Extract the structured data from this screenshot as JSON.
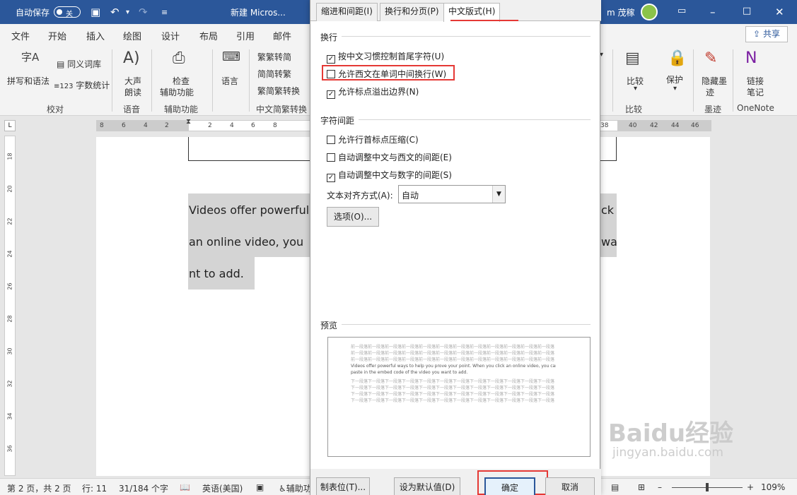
{
  "titlebar": {
    "autosave_label": "自动保存",
    "autosave_state": "关",
    "doc_title": "新建 Micros...",
    "user_name": "m 茂稼"
  },
  "ribbon_tabs": [
    "文件",
    "开始",
    "插入",
    "绘图",
    "设计",
    "布局",
    "引用",
    "邮件"
  ],
  "share_label": "共享",
  "ribbon": {
    "spell_label": "拼写和语法",
    "thesaurus_label": "同义词库",
    "wordcount_label": "字数统计",
    "proofing_group": "校对",
    "readaloud_label1": "大声",
    "readaloud_label2": "朗读",
    "speech_group": "语音",
    "check_label1": "检查",
    "check_label2": "辅助功能",
    "access_group": "辅助功能",
    "language_label": "语言",
    "trad_to_simp": "繁转简",
    "simp_to_trad": "简转繁",
    "convert_label": "简繁转换",
    "chinese_group": "中文简繁转换",
    "compare_label": "比较",
    "compare_group": "比较",
    "protect_label": "保护",
    "hide_ink_label1": "隐藏墨",
    "hide_ink_label2": "迹",
    "ink_group": "墨迹",
    "notes_label1": "链接",
    "notes_label2": "笔记",
    "onenote_group": "OneNote",
    "ruler_corner": "L"
  },
  "ruler": {
    "h_left": [
      "8",
      "6",
      "4",
      "2"
    ],
    "h_mid": [
      "2",
      "4",
      "6",
      "8"
    ],
    "h_right": [
      "38",
      "40",
      "42",
      "44",
      "46",
      "48"
    ],
    "v": [
      "18",
      "20",
      "22",
      "24",
      "26",
      "28",
      "30",
      "32",
      "34",
      "36"
    ]
  },
  "document": {
    "line1_left": "Videos offer powerful",
    "line1_right": "ck",
    "line2_left": "an online video, you",
    "line2_right": "wa",
    "line3": "nt to add."
  },
  "status": {
    "page": "第 2 页，共 2 页",
    "line": "行: 11",
    "words": "31/184 个字",
    "language": "英语(美国)",
    "accessibility": "辅助功",
    "zoom": "109%"
  },
  "dialog": {
    "tabs": [
      "缩进和间距(I)",
      "换行和分页(P)",
      "中文版式(H)"
    ],
    "line_break_section": "换行",
    "opt_kinsoku": "按中文习惯控制首尾字符(U)",
    "opt_kinsoku_checked": true,
    "opt_western_wrap": "允许西文在单词中间换行(W)",
    "opt_western_wrap_checked": false,
    "opt_punct_overflow": "允许标点溢出边界(N)",
    "opt_punct_overflow_checked": true,
    "spacing_section": "字符间距",
    "opt_compress": "允许行首标点压缩(C)",
    "opt_compress_checked": false,
    "opt_cn_west": "自动调整中文与西文的间距(E)",
    "opt_cn_west_checked": false,
    "opt_cn_num": "自动调整中文与数字的间距(S)",
    "opt_cn_num_checked": true,
    "align_label": "文本对齐方式(A):",
    "align_value": "自动",
    "options_button": "选项(O)...",
    "preview_section": "预览",
    "preview_prev": "前一段落前一段落前一段落前一段落前一段落前一段落前一段落前一段落前一段落前一段落前一段落前一段落",
    "preview_sample1": "Videos offer powerful ways to help you prove your point. When you click an online video, you can",
    "preview_sample2": "paste in the embed code of the video you want to add.",
    "preview_next": "下一段落下一段落下一段落下一段落下一段落下一段落下一段落下一段落下一段落下一段落下一段落下一段落",
    "tabs_button": "制表位(T)...",
    "default_button": "设为默认值(D)",
    "ok_button": "确定",
    "cancel_button": "取消"
  },
  "watermark": {
    "brand": "Baidu经验",
    "url": "jingyan.baidu.com"
  },
  "colors": {
    "titlebar": "#2b579a",
    "highlight": "#e53935"
  }
}
